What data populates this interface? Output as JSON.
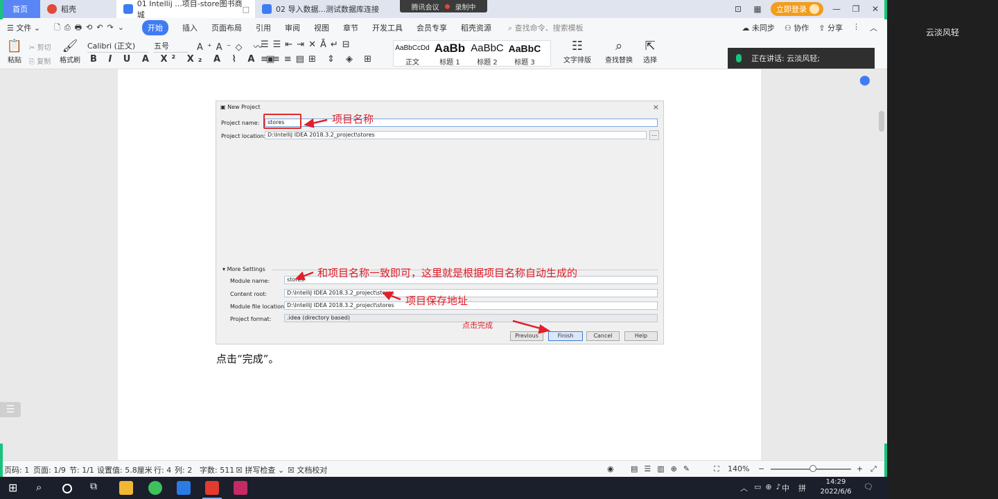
{
  "titlebar": {
    "home_tab": "首页",
    "tab_daoke": "稻壳",
    "tab_doc1": "01 Intellij ...项目-store图书商城",
    "tab_doc2": "02 导入数据...测试数据库连接",
    "meeting_label": "腾讯会议",
    "recording_label": "录制中",
    "login_label": "立即登录"
  },
  "menubar": {
    "file": "文件",
    "items": [
      "开始",
      "插入",
      "页面布局",
      "引用",
      "审阅",
      "视图",
      "章节",
      "开发工具",
      "会员专享",
      "稻壳资源"
    ],
    "search": "查找命令、搜索模板",
    "sync": "未同步",
    "collab": "协作",
    "share": "分享"
  },
  "ribbon": {
    "paste": "粘贴",
    "cut": "剪切",
    "copy": "复制",
    "format_painter": "格式刷",
    "font_name": "Calibri (正文)",
    "font_size": "五号",
    "styles": [
      {
        "sample": "AaBbCcDd",
        "name": "正文"
      },
      {
        "sample": "AaBb",
        "name": "标题 1"
      },
      {
        "sample": "AaBbC",
        "name": "标题 2"
      },
      {
        "sample": "AaBbC",
        "name": "标题 3"
      }
    ],
    "text_layout": "文字排版",
    "find_replace": "查找替换",
    "select": "选择"
  },
  "meeting_panel": {
    "speaking": "正在讲话: 云淡风轻;",
    "user_name": "云淡风轻"
  },
  "dialog": {
    "title": "New Project",
    "project_name_label": "Project name:",
    "project_name_value": "stores",
    "project_location_label": "Project location:",
    "project_location_value": "D:\\IntelliJ IDEA 2018.3.2_project\\stores",
    "more_settings": "More Settings",
    "module_name_label": "Module name:",
    "module_name_value": "stores",
    "content_root_label": "Content root:",
    "content_root_value": "D:\\IntelliJ IDEA 2018.3.2_project\\stores",
    "module_file_label": "Module file location:",
    "module_file_value": "D:\\IntelliJ IDEA 2018.3.2_project\\stores",
    "project_format_label": "Project format:",
    "project_format_value": ".idea (directory based)",
    "btn_previous": "Previous",
    "btn_finish": "Finish",
    "btn_cancel": "Cancel",
    "btn_help": "Help"
  },
  "annotations": {
    "project_name": "项目名称",
    "module_name": "和项目名称一致即可，这里就是根据项目名称自动生成的",
    "save_path": "项目保存地址",
    "click_finish": "点击完成"
  },
  "doc_text": "点击“完成”。",
  "statusbar": {
    "page_code": "页码: 1",
    "page": "页面: 1/9",
    "section": "节: 1/1",
    "setting": "设置值: 5.8厘米",
    "row": "行: 4",
    "col": "列: 2",
    "words": "字数: 511",
    "spell": "拼写检查",
    "proof": "文档校对",
    "zoom": "140%"
  },
  "taskbar": {
    "ime": "中",
    "ime2": "拼",
    "time": "14:29",
    "date": "2022/6/6"
  }
}
